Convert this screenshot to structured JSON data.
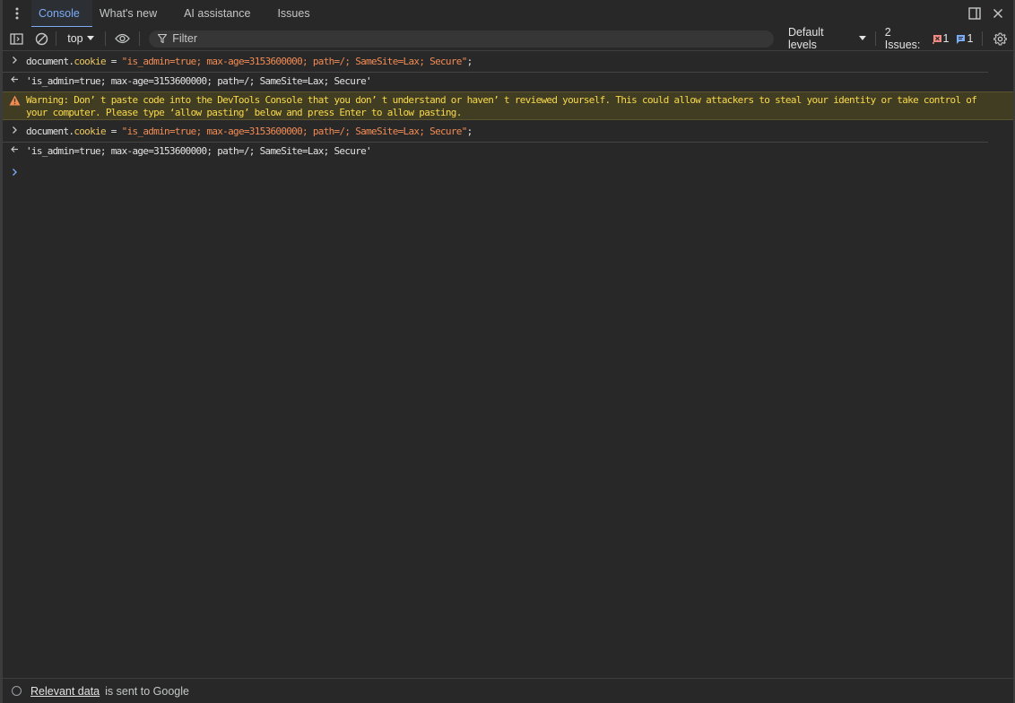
{
  "tabs": [
    {
      "label": "Console",
      "active": true
    },
    {
      "label": "What's new",
      "active": false
    },
    {
      "label": "AI assistance",
      "active": false
    },
    {
      "label": "Issues",
      "active": false
    }
  ],
  "toolbar": {
    "context": "top",
    "filter_placeholder": "Filter",
    "levels": "Default levels",
    "issues_label": "2 Issues:",
    "issues_error_count": "1",
    "issues_info_count": "1"
  },
  "console": {
    "input1": {
      "obj": "document",
      "prop": "cookie",
      "op": " = ",
      "str": "\"is_admin=true; max-age=3153600000; path=/; SameSite=Lax; Secure\"",
      "end": ";"
    },
    "result1": "'is_admin=true; max-age=3153600000; path=/; SameSite=Lax; Secure'",
    "warning": "Warning: Don’ t paste code into the DevTools Console that you don’ t understand or haven’ t reviewed yourself. This could allow attackers to steal your identity or take control of your computer. Please type  ‘allow pasting’  below and press Enter to allow pasting.",
    "input2": {
      "obj": "document",
      "prop": "cookie",
      "op": " = ",
      "str": "\"is_admin=true; max-age=3153600000; path=/; SameSite=Lax; Secure\"",
      "end": ";"
    },
    "result2": "'is_admin=true; max-age=3153600000; path=/; SameSite=Lax; Secure'"
  },
  "status": {
    "link": "Relevant data",
    "text": "is sent to Google"
  },
  "colors": {
    "accent": "#7cacf8",
    "warning_bg": "#413d23",
    "warning_text": "#f9d94a",
    "string": "#f28b54",
    "property": "#ecc660",
    "result": "#5cd5fb",
    "error_badge": "#f28b82",
    "info_badge": "#7cacf8"
  },
  "icons": {
    "menu": "more-vert-icon",
    "dock": "dock-side-icon",
    "close": "close-icon",
    "sidebar": "sidebar-toggle-icon",
    "clear": "clear-console-icon",
    "eye": "live-expression-icon",
    "filter": "filter-icon",
    "settings": "gear-icon"
  }
}
